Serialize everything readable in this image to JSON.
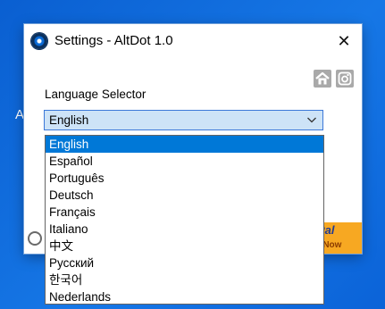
{
  "desktop": {
    "background_color": "#0a5fd1",
    "partial_label": "A"
  },
  "window": {
    "title": "Settings - AltDot 1.0",
    "close_icon": "close-icon",
    "app_icon": "app-icon"
  },
  "header_buttons": [
    {
      "name": "home-icon"
    },
    {
      "name": "instagram-icon"
    }
  ],
  "language": {
    "label": "Language Selector",
    "selected": "English",
    "options": [
      "English",
      "Español",
      "Português",
      "Deutsch",
      "Français",
      "Italiano",
      "中文",
      "Русский",
      "한국어",
      "Nederlands"
    ]
  },
  "footer": {
    "paypal_label_top": "Pal",
    "paypal_label_bottom": "e Now"
  },
  "colors": {
    "selection": "#0078d7",
    "combo_background": "#cde3f7",
    "combo_border": "#3c78d8",
    "paypal_orange": "#f7a822",
    "icon_gray": "#a9a9a9"
  }
}
